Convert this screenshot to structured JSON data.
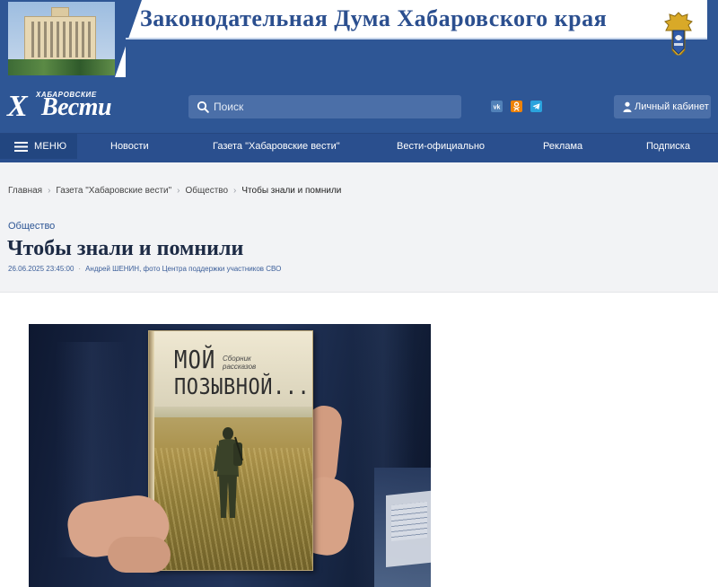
{
  "banner": {
    "title": "Законодательная Дума Хабаровского края"
  },
  "header": {
    "logo_small": "ХАБАРОВСКИЕ",
    "logo_x": "Х",
    "logo_main": "Вести",
    "search_placeholder": "Поиск",
    "cabinet_label": "Личный кабинет"
  },
  "social": [
    {
      "name": "vk-icon",
      "color": "#5181b8"
    },
    {
      "name": "odnoklassniki-icon",
      "color": "#ee8208"
    },
    {
      "name": "telegram-icon",
      "color": "#2aa3dd"
    }
  ],
  "nav": {
    "menu_label": "МЕНЮ",
    "items": [
      "Новости",
      "Газета \"Хабаровские вести\"",
      "Вести-официально",
      "Реклама",
      "Подписка"
    ]
  },
  "breadcrumb": {
    "items": [
      "Главная",
      "Газета \"Хабаровские вести\"",
      "Общество"
    ],
    "current": "Чтобы знали и помнили"
  },
  "article": {
    "category": "Общество",
    "title": "Чтобы знали и помнили",
    "date": "26.06.2025 23:45:00",
    "author": "Андрей ШЕНИН, фото Центра поддержки участников СВО"
  },
  "book": {
    "line1": "МОЙ",
    "subtitle": "Сборник рассказов",
    "line2": "ПОЗЫВНОЙ..."
  },
  "colors": {
    "brand_blue": "#2e5695",
    "nav_blue": "#2a4f8e",
    "strip_gray": "#f2f3f5"
  }
}
